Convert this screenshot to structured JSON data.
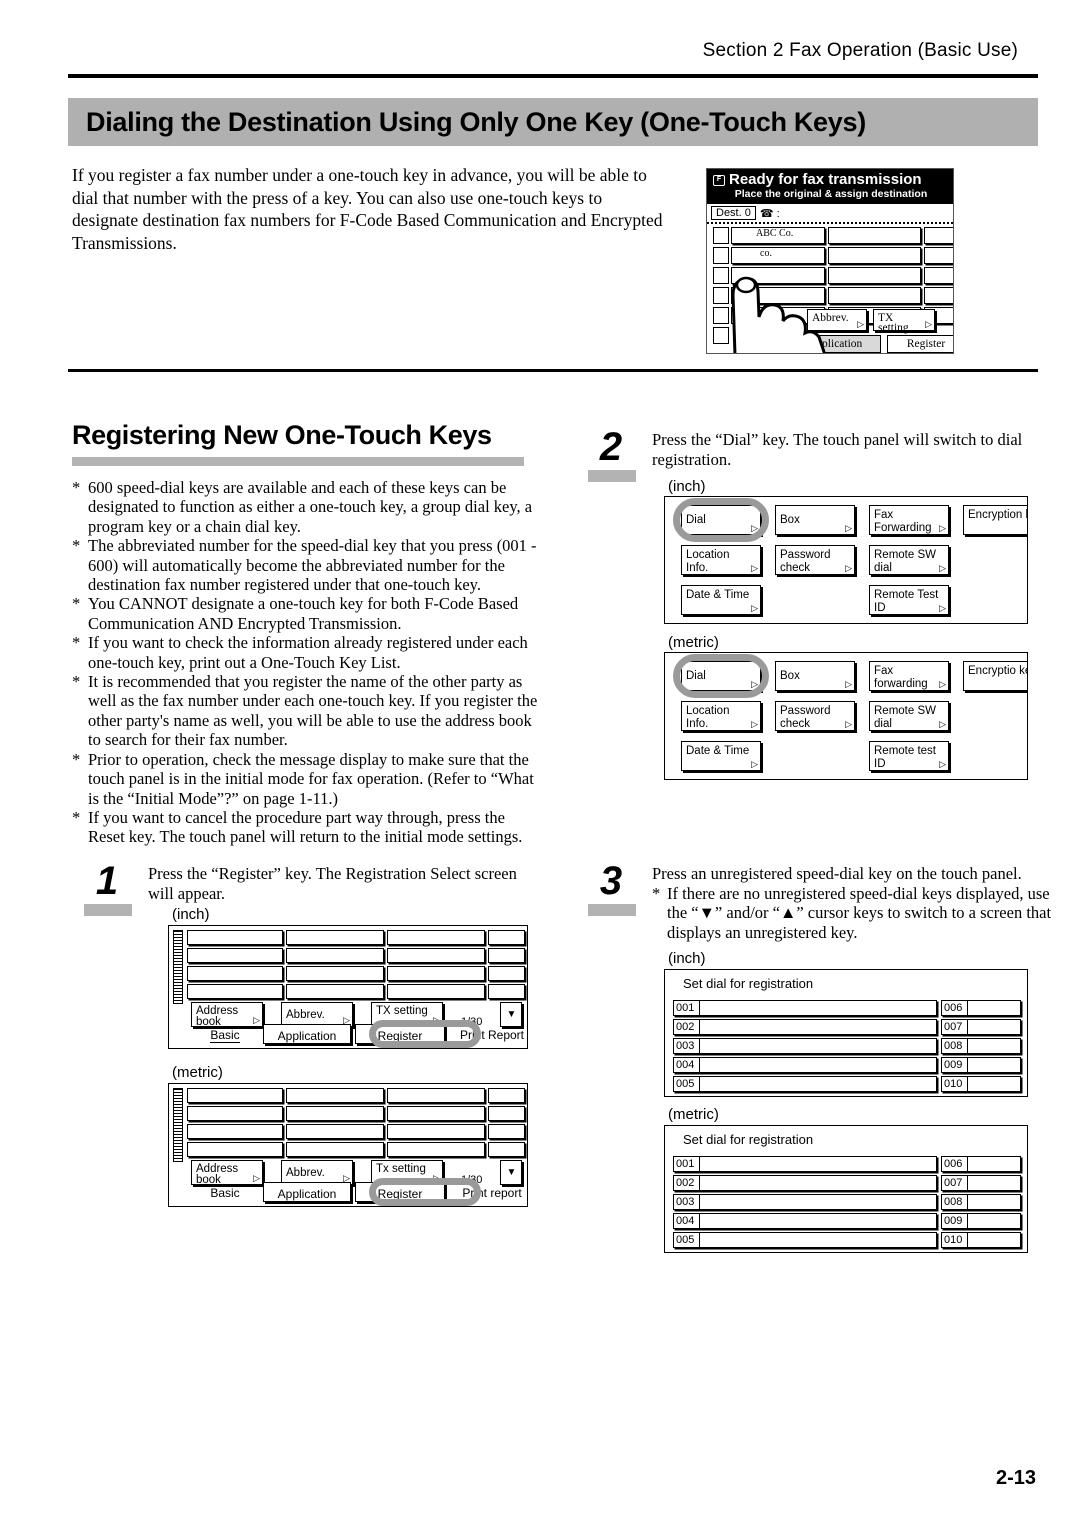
{
  "running_head": "Section 2  Fax Operation (Basic Use)",
  "title": "Dialing the Destination Using Only One Key  (One-Touch Keys)",
  "intro": "If you register a fax number under a one-touch key in advance, you will be able to dial that number with the press of a key. You can also use one-touch keys to designate destination fax numbers for F-Code Based Communication and Encrypted Transmissions.",
  "status_lcd": {
    "line1": "Ready for fax transmission",
    "line2": "Place the original & assign destination",
    "dest_label": "Dest. 0",
    "phone_glyph": "☎ :",
    "fax_glyph": "F",
    "entries": [
      "ABC Co.",
      "co."
    ],
    "buttons": [
      "Abbrev.",
      "TX setting"
    ],
    "tabs": [
      "Application",
      "Register"
    ]
  },
  "section": {
    "heading": "Registering New One-Touch Keys",
    "bullets": [
      "600 speed-dial keys are available and each of these keys can be designated to function as either a one-touch key, a group dial key, a program key or a chain dial key.",
      "The abbreviated number for the speed-dial key that you press (001 - 600) will automatically become the abbreviated number for the destination fax number registered under that one-touch key.",
      "You CANNOT designate a one-touch key for both F-Code Based Communication AND Encrypted Transmission.",
      "If you want to check the information already registered under each one-touch key, print out a One-Touch Key List.",
      "It is recommended that you register the name of the other party as well as the fax number under each one-touch key. If you register the other party's name as well, you will be able to use the address book to search for their fax number.",
      "Prior to operation, check the message display to make sure that the touch panel is in the initial mode for fax operation. (Refer to “What is the “Initial Mode”?” on page 1-11.)",
      "If you want to cancel the procedure part way through, press the Reset key. The touch panel will return to the initial mode settings."
    ],
    "bullet_marker": "*"
  },
  "steps": {
    "step1": {
      "number": "1",
      "text": "Press the “Register” key. The Registration Select screen will appear.",
      "caption_inch": "(inch)",
      "caption_metric": "(metric)",
      "inch": {
        "buttons": [
          "Address book",
          "Abbrev.",
          "TX setting"
        ],
        "page_indicator": "1/30",
        "tabs": [
          "Basic",
          "Application",
          "Register",
          "Print Report"
        ],
        "highlighted_tab": "Register",
        "scroll_glyph": "▼"
      },
      "metric": {
        "buttons": [
          "Address book",
          "Abbrev.",
          "Tx setting"
        ],
        "page_indicator": "1/30",
        "tabs": [
          "Basic",
          "Application",
          "Register",
          "Print report"
        ],
        "highlighted_tab": "Register",
        "scroll_glyph": "▼"
      }
    },
    "step2": {
      "number": "2",
      "text": "Press the “Dial” key. The touch panel will switch to dial registration.",
      "caption_inch": "(inch)",
      "caption_metric": "(metric)",
      "inch": {
        "keys": [
          [
            "Dial",
            "Box",
            "Fax Forwarding",
            "Encryption key"
          ],
          [
            "Location Info.",
            "Password check",
            "Remote SW dial",
            ""
          ],
          [
            "Date & Time",
            "",
            "Remote Test ID",
            ""
          ]
        ],
        "highlighted_key": "Dial"
      },
      "metric": {
        "keys": [
          [
            "Dial",
            "Box",
            "Fax forwarding",
            "Encryptio key"
          ],
          [
            "Location Info.",
            "Password check",
            "Remote SW dial",
            ""
          ],
          [
            "Date & Time",
            "",
            "Remote test ID",
            ""
          ]
        ],
        "highlighted_key": "Dial"
      }
    },
    "step3": {
      "number": "3",
      "text": "Press an unregistered speed-dial key on the touch panel.",
      "note": "If there are no unregistered speed-dial keys displayed, use the “▼” and/or “▲” cursor keys to switch to a screen that displays an unregistered key.",
      "note_marker": "*",
      "caption_inch": "(inch)",
      "caption_metric": "(metric)",
      "panel_title": "Set dial for registration",
      "left_keys": [
        "001",
        "002",
        "003",
        "004",
        "005"
      ],
      "right_keys": [
        "006",
        "007",
        "008",
        "009",
        "010"
      ]
    }
  },
  "page_number": "2-13",
  "colors": {
    "title_bar": "#b0b0b0",
    "accent_bar": "#b3b3b3",
    "highlight_ring": "#9a9a9a"
  }
}
